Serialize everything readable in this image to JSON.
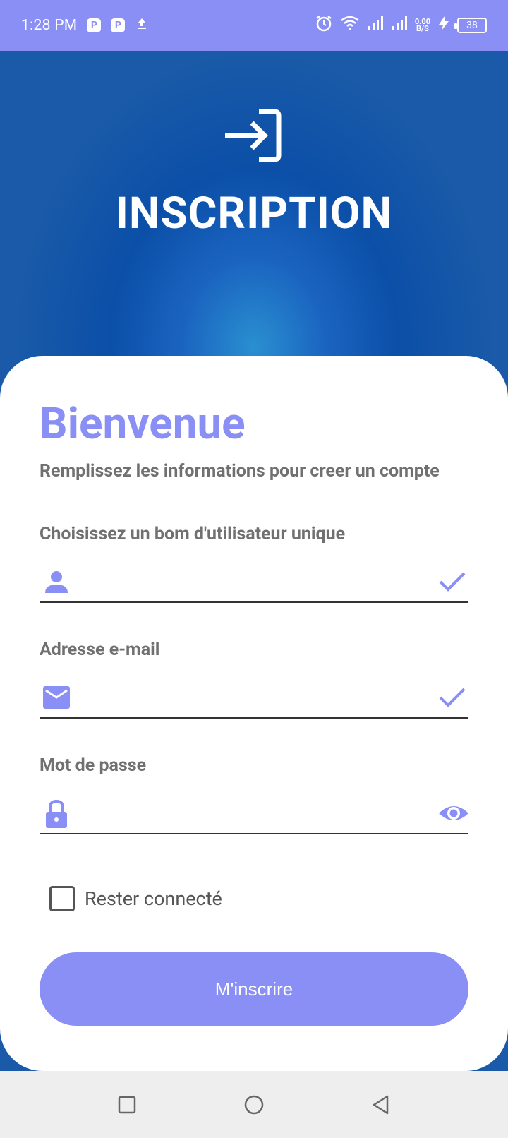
{
  "status_bar": {
    "time": "1:28 PM",
    "notification_icons": [
      "p-app-icon",
      "p-app-icon",
      "upload-icon"
    ],
    "speed_top": "0.00",
    "speed_bottom": "B/S",
    "battery": "38"
  },
  "hero": {
    "icon": "login-icon",
    "title": "INSCRIPTION"
  },
  "form": {
    "welcome": "Bienvenue",
    "subtitle": "Remplissez les informations pour creer un compte",
    "username": {
      "label": "Choisissez un bom d'utilisateur unique",
      "value": "",
      "lead_icon": "person-icon",
      "trail_icon": "check-icon"
    },
    "email": {
      "label": "Adresse e-mail",
      "value": "",
      "lead_icon": "mail-icon",
      "trail_icon": "check-icon"
    },
    "password": {
      "label": "Mot de passe",
      "value": "",
      "lead_icon": "lock-icon",
      "trail_icon": "eye-icon"
    },
    "remember": {
      "label": "Rester connecté",
      "checked": false
    },
    "submit_label": "M'inscrire"
  },
  "colors": {
    "accent": "#8a8ff6",
    "hero_blue": "#0b4fa8",
    "text_gray": "#707070"
  },
  "nav": {
    "buttons": [
      "recents-square-icon",
      "home-circle-icon",
      "back-triangle-icon"
    ]
  }
}
